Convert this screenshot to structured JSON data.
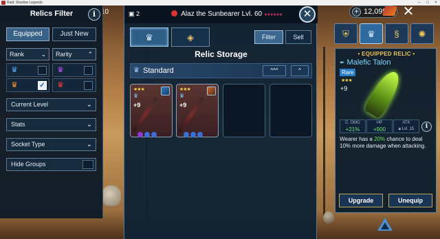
{
  "window": {
    "title": "Raid: Shadow Legends"
  },
  "hud": {
    "level_fragment": "10",
    "currency_value": "12,095",
    "plus_label": "+",
    "close_glyph": "✕"
  },
  "filter": {
    "title": "Relics Filter",
    "info_glyph": "i",
    "tabs": [
      "Equipped",
      "Just New"
    ],
    "rank_label": "Rank",
    "rarity_label": "Rarity",
    "chevron_down": "⌄",
    "chevron_up": "⌃",
    "check_glyph": "✓",
    "current_level": "Current Level",
    "stats": "Stats",
    "socket_type": "Socket Type",
    "hide_groups": "Hide Groups"
  },
  "storage": {
    "count": "2",
    "hero_name": "Alaz the Sunbearer Lvl. 60",
    "hero_stars": "★★★★★★",
    "close_glyph": "✕",
    "filter_label": "Filter",
    "sell_label": "Sell",
    "title": "Relic Storage",
    "group_label": "Standard",
    "collapse_all": "^^^",
    "collapse": "^",
    "slots": [
      {
        "level": "+9",
        "stars": "★★★"
      },
      {
        "level": "+9",
        "stars": "★★★"
      }
    ]
  },
  "equipped": {
    "title": "EQUIPPED RELIC",
    "name": "Malefic Talon",
    "rarity": "Rare",
    "stars": "★★★",
    "level": "+9",
    "stats": [
      {
        "label": "C. DMG",
        "value": "+21%"
      },
      {
        "label": "HP",
        "value": "+900"
      },
      {
        "label": "ATK",
        "value": "Lvl. 15"
      }
    ],
    "desc_before": "Wearer has a ",
    "desc_highlight": "20%",
    "desc_after": " chance to deal 10% more damage when attacking.",
    "upgrade_label": "Upgrade",
    "unequip_label": "Unequip"
  },
  "colors": {
    "accent": "#3b678f",
    "rare": "#2a7ec7",
    "gold": "#f0c75a",
    "positive": "#6fe36f"
  },
  "icons": [
    "crown-icon",
    "diamond-icon",
    "skull-icon",
    "chest-icon",
    "shield-icon",
    "helix-icon",
    "gear-icon",
    "arrow-up-icon"
  ]
}
